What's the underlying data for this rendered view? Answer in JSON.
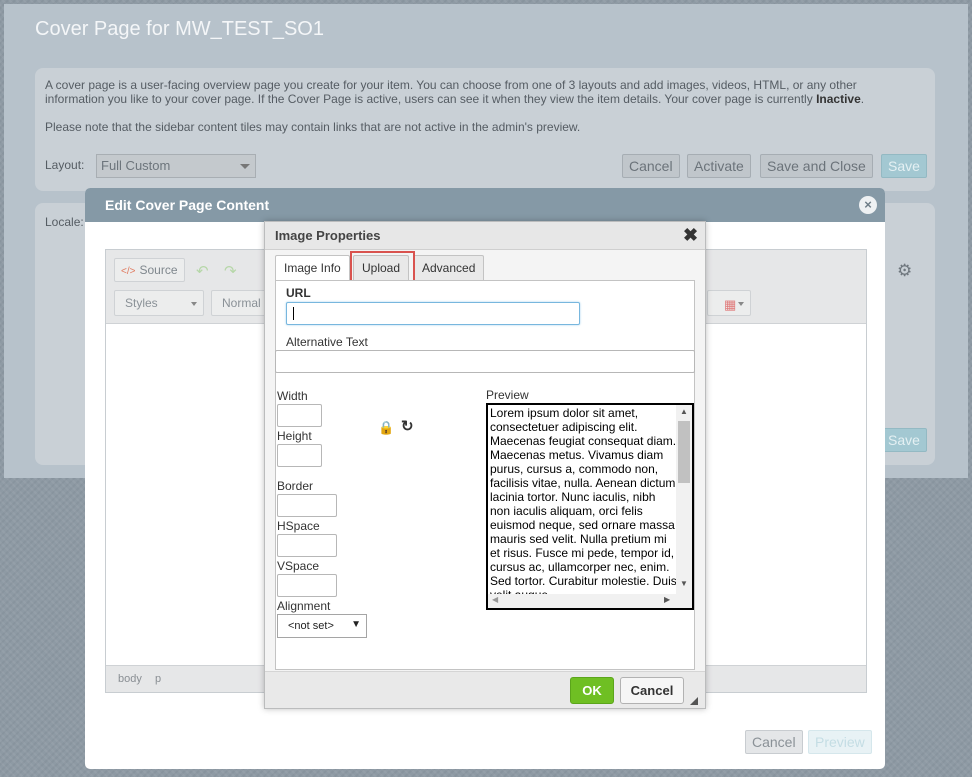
{
  "page": {
    "title": "Cover Page for MW_TEST_SO1",
    "info_line1": "A cover page is a user-facing overview page you create for your item. You can choose from one of 3 layouts and add images, videos, HTML, or any other",
    "info_line2": "information you like to your cover page. If the Cover Page is active, users can see it when they view the item details. Your cover page is currently",
    "info_status": "Inactive",
    "info_period": ".",
    "note": "Please note that the sidebar content tiles may contain links that are not active in the admin's preview.",
    "layout_label": "Layout:",
    "layout_value": "Full Custom",
    "buttons": {
      "cancel": "Cancel",
      "activate": "Activate",
      "save_close": "Save and Close",
      "save": "Save"
    },
    "locale_label": "Locale:"
  },
  "edit_modal": {
    "title": "Edit Cover Page Content",
    "close_glyph": "×",
    "toolbar": {
      "source": "Source",
      "styles": "Styles",
      "format": "Normal"
    },
    "status_path": [
      "body",
      "p"
    ],
    "buttons": {
      "cancel": "Cancel",
      "preview": "Preview"
    }
  },
  "image_dialog": {
    "title": "Image Properties",
    "close_glyph": "✖",
    "tabs": [
      {
        "label": "Image Info",
        "active": true
      },
      {
        "label": "Upload",
        "active": false,
        "highlighted": true
      },
      {
        "label": "Advanced",
        "active": false
      }
    ],
    "fields": {
      "url_label": "URL",
      "url_value": "",
      "alt_label": "Alternative Text",
      "width_label": "Width",
      "height_label": "Height",
      "border_label": "Border",
      "hspace_label": "HSpace",
      "vspace_label": "VSpace",
      "alignment_label": "Alignment",
      "alignment_value": "<not set>"
    },
    "preview_label": "Preview",
    "preview_text": "Lorem ipsum dolor sit amet, consectetuer adipiscing elit. Maecenas feugiat consequat diam. Maecenas metus. Vivamus diam purus, cursus a, commodo non, facilisis vitae, nulla. Aenean dictum lacinia tortor. Nunc iaculis, nibh non iaculis aliquam, orci felis euismod neque, sed ornare massa mauris sed velit. Nulla pretium mi et risus. Fusce mi pede, tempor id, cursus ac, ullamcorper nec, enim. Sed tortor. Curabitur molestie. Duis velit augue",
    "buttons": {
      "ok": "OK",
      "cancel": "Cancel"
    }
  },
  "icons": {
    "source": "source-icon",
    "undo": "undo-icon",
    "redo": "redo-icon",
    "table": "table-icon",
    "gear": "gear-icon",
    "lock": "lock-icon",
    "reset": "reset-size-icon"
  },
  "colors": {
    "ok_green": "#6fbf23",
    "highlight_red": "#d9534f",
    "modal_header": "#8599a6",
    "save_blue": "#a3c8d2"
  }
}
